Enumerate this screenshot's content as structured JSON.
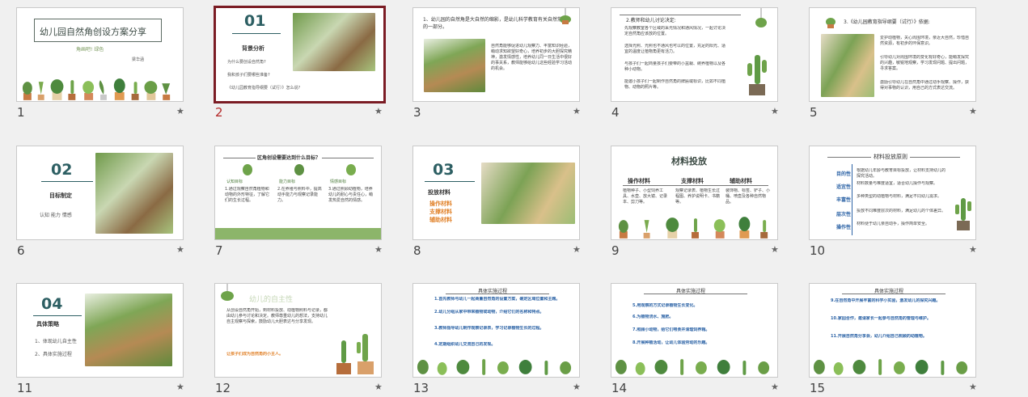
{
  "slides": [
    {
      "number": "1",
      "title": "幼儿园自然角创设方案分享",
      "subtitle": "角画吧! 绿色",
      "presenter": "梁华涵"
    },
    {
      "number": "2",
      "index": "01",
      "heading": "背景分析",
      "bullets": [
        "为什么要创设自然角?",
        "我和孩子们要哪些准备?",
        "《幼儿园教育指导纲要（试行）》怎么说?"
      ]
    },
    {
      "number": "3",
      "heading": "1、幼儿园的自然角是大自然的缩影，是幼儿科学教育有关自然常识的一部分。",
      "body": "自然角能够促进幼儿观察力、丰富知识经验，萌动求知欲望好奇心，培养初步的大胆探究精神，激发情感性，培养幼儿同一日生活中很好的事关系，教师能够给幼儿这些经验学习活动的机会。"
    },
    {
      "number": "4",
      "heading": "2.教师和幼儿讨论决定:",
      "bullets": [
        "先观察教室各个区域的采光情况和通风情况，一起讨论决定自然角应该放的位置。",
        "选择光照、光照也不通风也可以的位置，充足的阳光、适宜的温度让植物角更有活力。",
        "与孩子们一起商量孩子们要带的小盆栽、碗养植物以及各种小动物。",
        "能邀小孩子们一起制作自然角的牌匾或标识，比如不同植物、动物的照片等。"
      ]
    },
    {
      "number": "5",
      "heading": "3.《幼儿园教育指导纲要（试行）》依据:",
      "bullets": [
        "爱护动植物，关心周围环境，亲近大自然，珍惜自然资源，有初步的环保意识。",
        "引导幼儿对周围环境的变化有好奇心，能萌发探究的兴趣，敏锐地观察，学习发现问题、提出问题，寻求答案。",
        "激励引导幼儿在自然角中通过动手观察、操作，获得对事物的认识，用自己的方式表达交流。"
      ]
    },
    {
      "number": "6",
      "index": "02",
      "heading": "目标制定",
      "tags": "认知 能力 情感"
    },
    {
      "number": "7",
      "heading": "区角创设需要达到什么目标？",
      "columns": [
        {
          "label": "认知目标",
          "text": "1.通过观察自然角植物和动物的外形特征，了解它们的生长过程。"
        },
        {
          "label": "能力目标",
          "text": "2.在养殖与照料中，提高动手能力与观察记录能力。"
        },
        {
          "label": "情感目标",
          "text": "3.通过照顾动植物，培养幼儿的耐心与责任心，萌发热爱自然的情感。"
        }
      ]
    },
    {
      "number": "8",
      "index": "03",
      "heading": "投放材料",
      "items": [
        "操作材料",
        "支撑材料",
        "辅助材料"
      ]
    },
    {
      "number": "9",
      "heading": "材料投放",
      "columns": [
        {
          "label": "操作材料",
          "text": "植物种子、小型饲养工具、水壶、放大镜、记录本、剪刀等。"
        },
        {
          "label": "支撑材料",
          "text": "观察记录表、植物生长过程图、养护说明卡、书籍等。"
        },
        {
          "label": "辅助材料",
          "text": "装饰物、标签、铲子、小桶、喷壶及各种自然物品。"
        }
      ]
    },
    {
      "number": "10",
      "heading": "材料投放原则",
      "rows": [
        {
          "label": "目的性",
          "text": "根据幼儿年龄与教育目标投放，让材料支持幼儿的探究活动。"
        },
        {
          "label": "适宜性",
          "text": "材料数量与难度适宜，适合幼儿操作与观察。"
        },
        {
          "label": "丰富性",
          "text": "多种类型的动植物与材料，满足不同幼儿需求。"
        },
        {
          "label": "层次性",
          "text": "投放不同难度层次的材料，满足幼儿的个体差异。"
        },
        {
          "label": "操作性",
          "text": "材料便于幼儿亲自动手，操作简单安全。"
        }
      ]
    },
    {
      "number": "11",
      "index": "04",
      "heading": "具体策略",
      "bullets": [
        "1、体现幼儿自主性",
        "2、具体实施过程"
      ]
    },
    {
      "number": "12",
      "heading": "幼儿的自主性",
      "body": "从创设自然角开始，到材料投放、动植物照料与记录，都由幼儿参与讨论和决定。教师尊重幼儿的想法，支持幼儿自主观察与探索，鼓励幼儿大胆表达与分享发现。",
      "highlight": "让孩子们成为自然角的小主人。"
    },
    {
      "number": "13",
      "heading": "具体实施过程",
      "bullets": [
        "1.首先教师与幼儿一起商量自然角的设置方案，确定区域位置和主题。",
        "2.幼儿分组从家中带来植物或动物，介绍它们的名称和特点。",
        "3.教师指导幼儿制作观察记录表，学习记录植物生长的过程。",
        "4.定期组织幼儿交流自己的发现。"
      ]
    },
    {
      "number": "14",
      "heading": "具体实施过程",
      "bullets": [
        "5.用观察的方式记录植物生长变化。",
        "6.为植物浇水、施肥。",
        "7.照顾小动物，给它们喂食并清理饲养箱。",
        "8.开展种植活动，让幼儿体验劳动的乐趣。"
      ]
    },
    {
      "number": "15",
      "heading": "具体实施过程",
      "bullets": [
        "9.在自然角中开展丰富的科学小实验，激发幼儿的探究兴趣。",
        "10.家园合作，邀请家长一起参与自然角的管理与维护。",
        "11.开展自然角分享会，幼儿介绍自己照顾的动植物。"
      ]
    }
  ],
  "selected_slide": "2",
  "star_glyph": "★",
  "colors": {
    "selected_border": "#7b1c24",
    "selected_number": "#b42828",
    "accent_orange": "#e1822a",
    "accent_blue": "#2c63a6",
    "title_teal": "#2d5f63"
  }
}
